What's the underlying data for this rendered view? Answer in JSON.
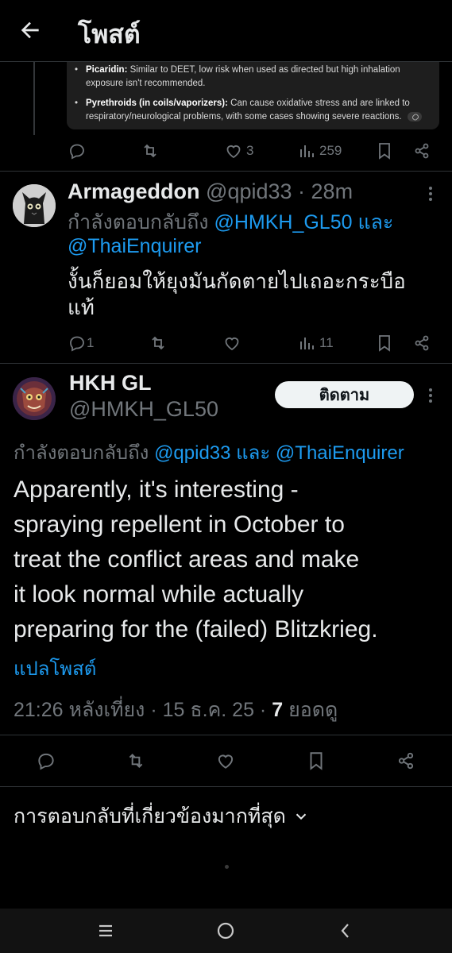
{
  "header": {
    "title": "โพสต์"
  },
  "quote_card": {
    "item1_term": "Picaridin:",
    "item1_text": "Similar to DEET, low risk when used as directed but high inhalation exposure isn't recommended.",
    "item2_term": "Pyrethroids (in coils/vaporizers):",
    "item2_text": "Can cause oxidative stress and are linked to respiratory/neurological problems, with some cases showing severe reactions."
  },
  "post1_actions": {
    "likes": "3",
    "views": "259"
  },
  "reply": {
    "name": "Armageddon",
    "handle": "@qpid33",
    "time": "· 28m",
    "replying_prefix": "กำลังตอบกลับถึง",
    "mention1": "@HMKH_GL50",
    "conj": "และ",
    "mention2": "@ThaiEnquirer",
    "text_line1": "งั้นก็ยอมให้ยุงมันกัดตายไปเถอะกระบือ",
    "text_line2": "แท้",
    "replies": "1",
    "views": "11"
  },
  "main_post": {
    "name": "HKH GL",
    "handle": "@HMKH_GL50",
    "follow_label": "ติดตาม",
    "replying_prefix": "กำลังตอบกลับถึง",
    "mention1": "@qpid33",
    "conj": "และ",
    "mention2": "@ThaiEnquirer",
    "text_lines": [
      "Apparently, it's interesting -",
      "spraying repellent in October to",
      "treat the conflict areas and make",
      "it look normal while actually",
      "preparing for the (failed) Blitzkrieg."
    ],
    "translate": "แปลโพสต์",
    "timestamp": "21:26 หลังเที่ยง · 15 ธ.ค. 25 ·",
    "view_count": "7",
    "view_label": "ยอดดู"
  },
  "sort": {
    "label": "การตอบกลับที่เกี่ยวข้องมากที่สุด"
  },
  "colors": {
    "accent": "#1d9bf0",
    "muted": "#71767b",
    "text": "#e7e9ea",
    "background": "#000000"
  }
}
